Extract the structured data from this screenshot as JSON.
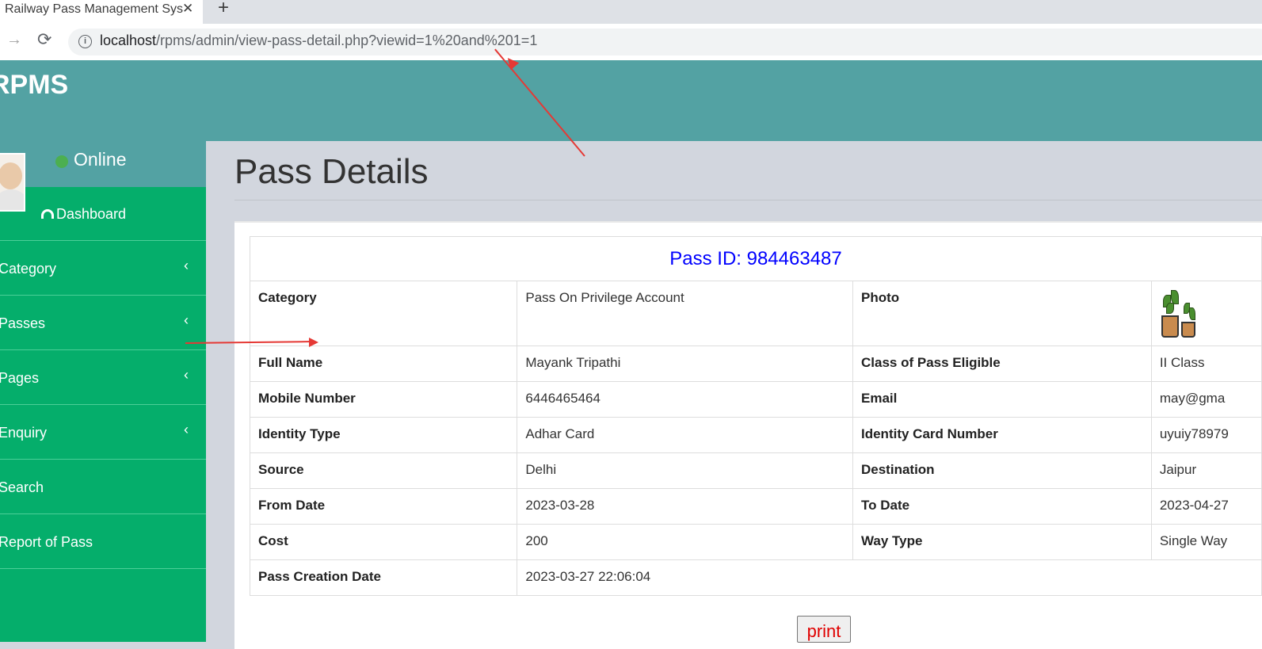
{
  "browser": {
    "tab_title": "Railway Pass Management Sys",
    "close_glyph": "✕",
    "new_tab_glyph": "+",
    "url_host": "localhost",
    "url_path": "/rpms/admin/view-pass-detail.php?viewid=1%20and%201=1"
  },
  "header": {
    "logo": "RPMS"
  },
  "sidebar": {
    "status": "Online",
    "items": [
      {
        "label": "Dashboard",
        "icon": "dashboard-icon"
      },
      {
        "label": "Category",
        "icon": "chevron-left-icon"
      },
      {
        "label": "Passes",
        "icon": "chevron-left-icon"
      },
      {
        "label": "Pages",
        "icon": "chevron-left-icon"
      },
      {
        "label": "Enquiry",
        "icon": "chevron-left-icon"
      },
      {
        "label": "Search"
      },
      {
        "label": "Report of Pass"
      }
    ]
  },
  "page": {
    "title": "Pass Details",
    "pass_id_label": "Pass ID: 984463487",
    "print_label": "print"
  },
  "details": {
    "category_label": "Category",
    "category_value": "Pass On Privilege Account",
    "photo_label": "Photo",
    "full_name_label": "Full Name",
    "full_name_value": "Mayank Tripathi",
    "class_label": "Class of Pass Eligible",
    "class_value": "II Class",
    "mobile_label": "Mobile Number",
    "mobile_value": "6446465464",
    "email_label": "Email",
    "email_value": "may@gma",
    "identity_type_label": "Identity Type",
    "identity_type_value": "Adhar Card",
    "identity_number_label": "Identity Card Number",
    "identity_number_value": "uyuiy78979",
    "source_label": "Source",
    "source_value": "Delhi",
    "destination_label": "Destination",
    "destination_value": "Jaipur",
    "from_date_label": "From Date",
    "from_date_value": "2023-03-28",
    "to_date_label": "To Date",
    "to_date_value": "2023-04-27",
    "cost_label": "Cost",
    "cost_value": "200",
    "way_type_label": "Way Type",
    "way_type_value": "Single Way",
    "creation_label": "Pass Creation Date",
    "creation_value": "2023-03-27 22:06:04"
  },
  "colors": {
    "header": "#53a2a3",
    "sidebar": "#05ae6b",
    "annotation": "#e53935",
    "pass_id": "#0000ff",
    "print_text": "#e00000"
  }
}
